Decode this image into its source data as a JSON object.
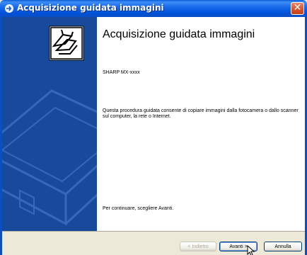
{
  "window": {
    "title": "Acquisizione guidata immagini"
  },
  "content": {
    "heading": "Acquisizione guidata immagini",
    "device_name": "SHARP MX-xxxx",
    "description": "Questa procedura guidata consente di copiare immagini dalla fotocamera o dallo scanner sul computer, la rete o Internet.",
    "continue_text": "Per continuare, scegliere Avanti."
  },
  "buttons": {
    "back": "< Indietro",
    "next": "Avanti >",
    "cancel": "Annulla"
  },
  "colors": {
    "title_bar": "#0A5BD6",
    "side_panel": "#184A9C",
    "close_button": "#D9532B"
  }
}
